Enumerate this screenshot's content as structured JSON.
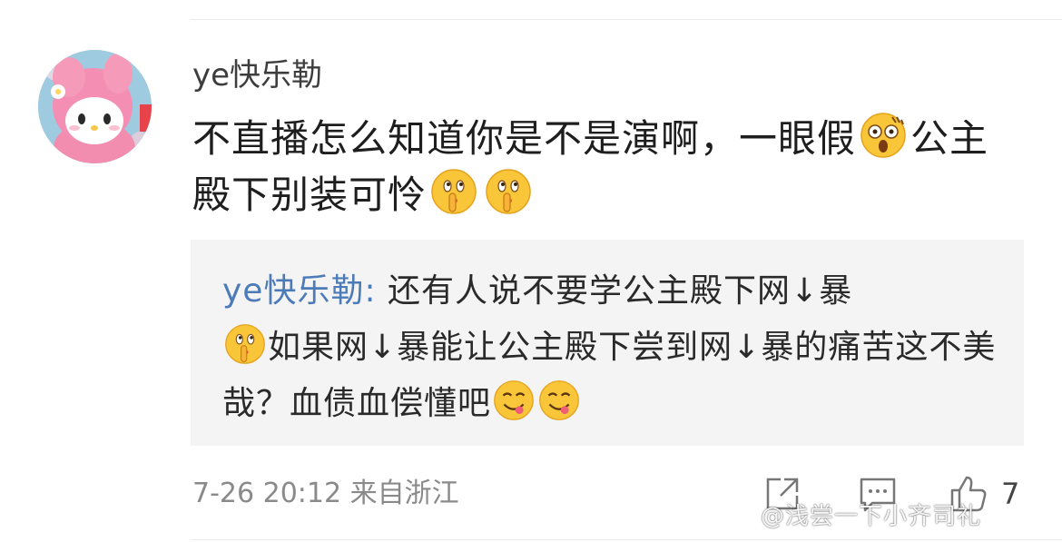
{
  "comment": {
    "username": "ye快乐勒",
    "text_part1": "不直播怎么知道你是不是演啊，一眼假",
    "text_part2": "公主殿下别装可怜",
    "emojis": [
      "shocked-emoji",
      "shush-thinking-emoji",
      "shush-thinking-emoji"
    ]
  },
  "quote": {
    "author": "ye快乐勒:",
    "text_part1": " 还有人说不要学公主殿下网↓暴",
    "text_part2": "如果网↓暴能让公主殿下尝到网↓暴的痛苦这不美哉？血债血偿懂吧",
    "emojis": [
      "shush-thinking-emoji",
      "yum-emoji",
      "yum-emoji"
    ]
  },
  "meta": {
    "timestamp": "7-26 20:12 来自浙江",
    "like_count": "7"
  },
  "watermark": "@浅尝一下小齐司礼",
  "colors": {
    "accent_link": "#4c7bb8",
    "quote_bg": "#f4f4f4",
    "meta_text": "#8a8a8a"
  }
}
